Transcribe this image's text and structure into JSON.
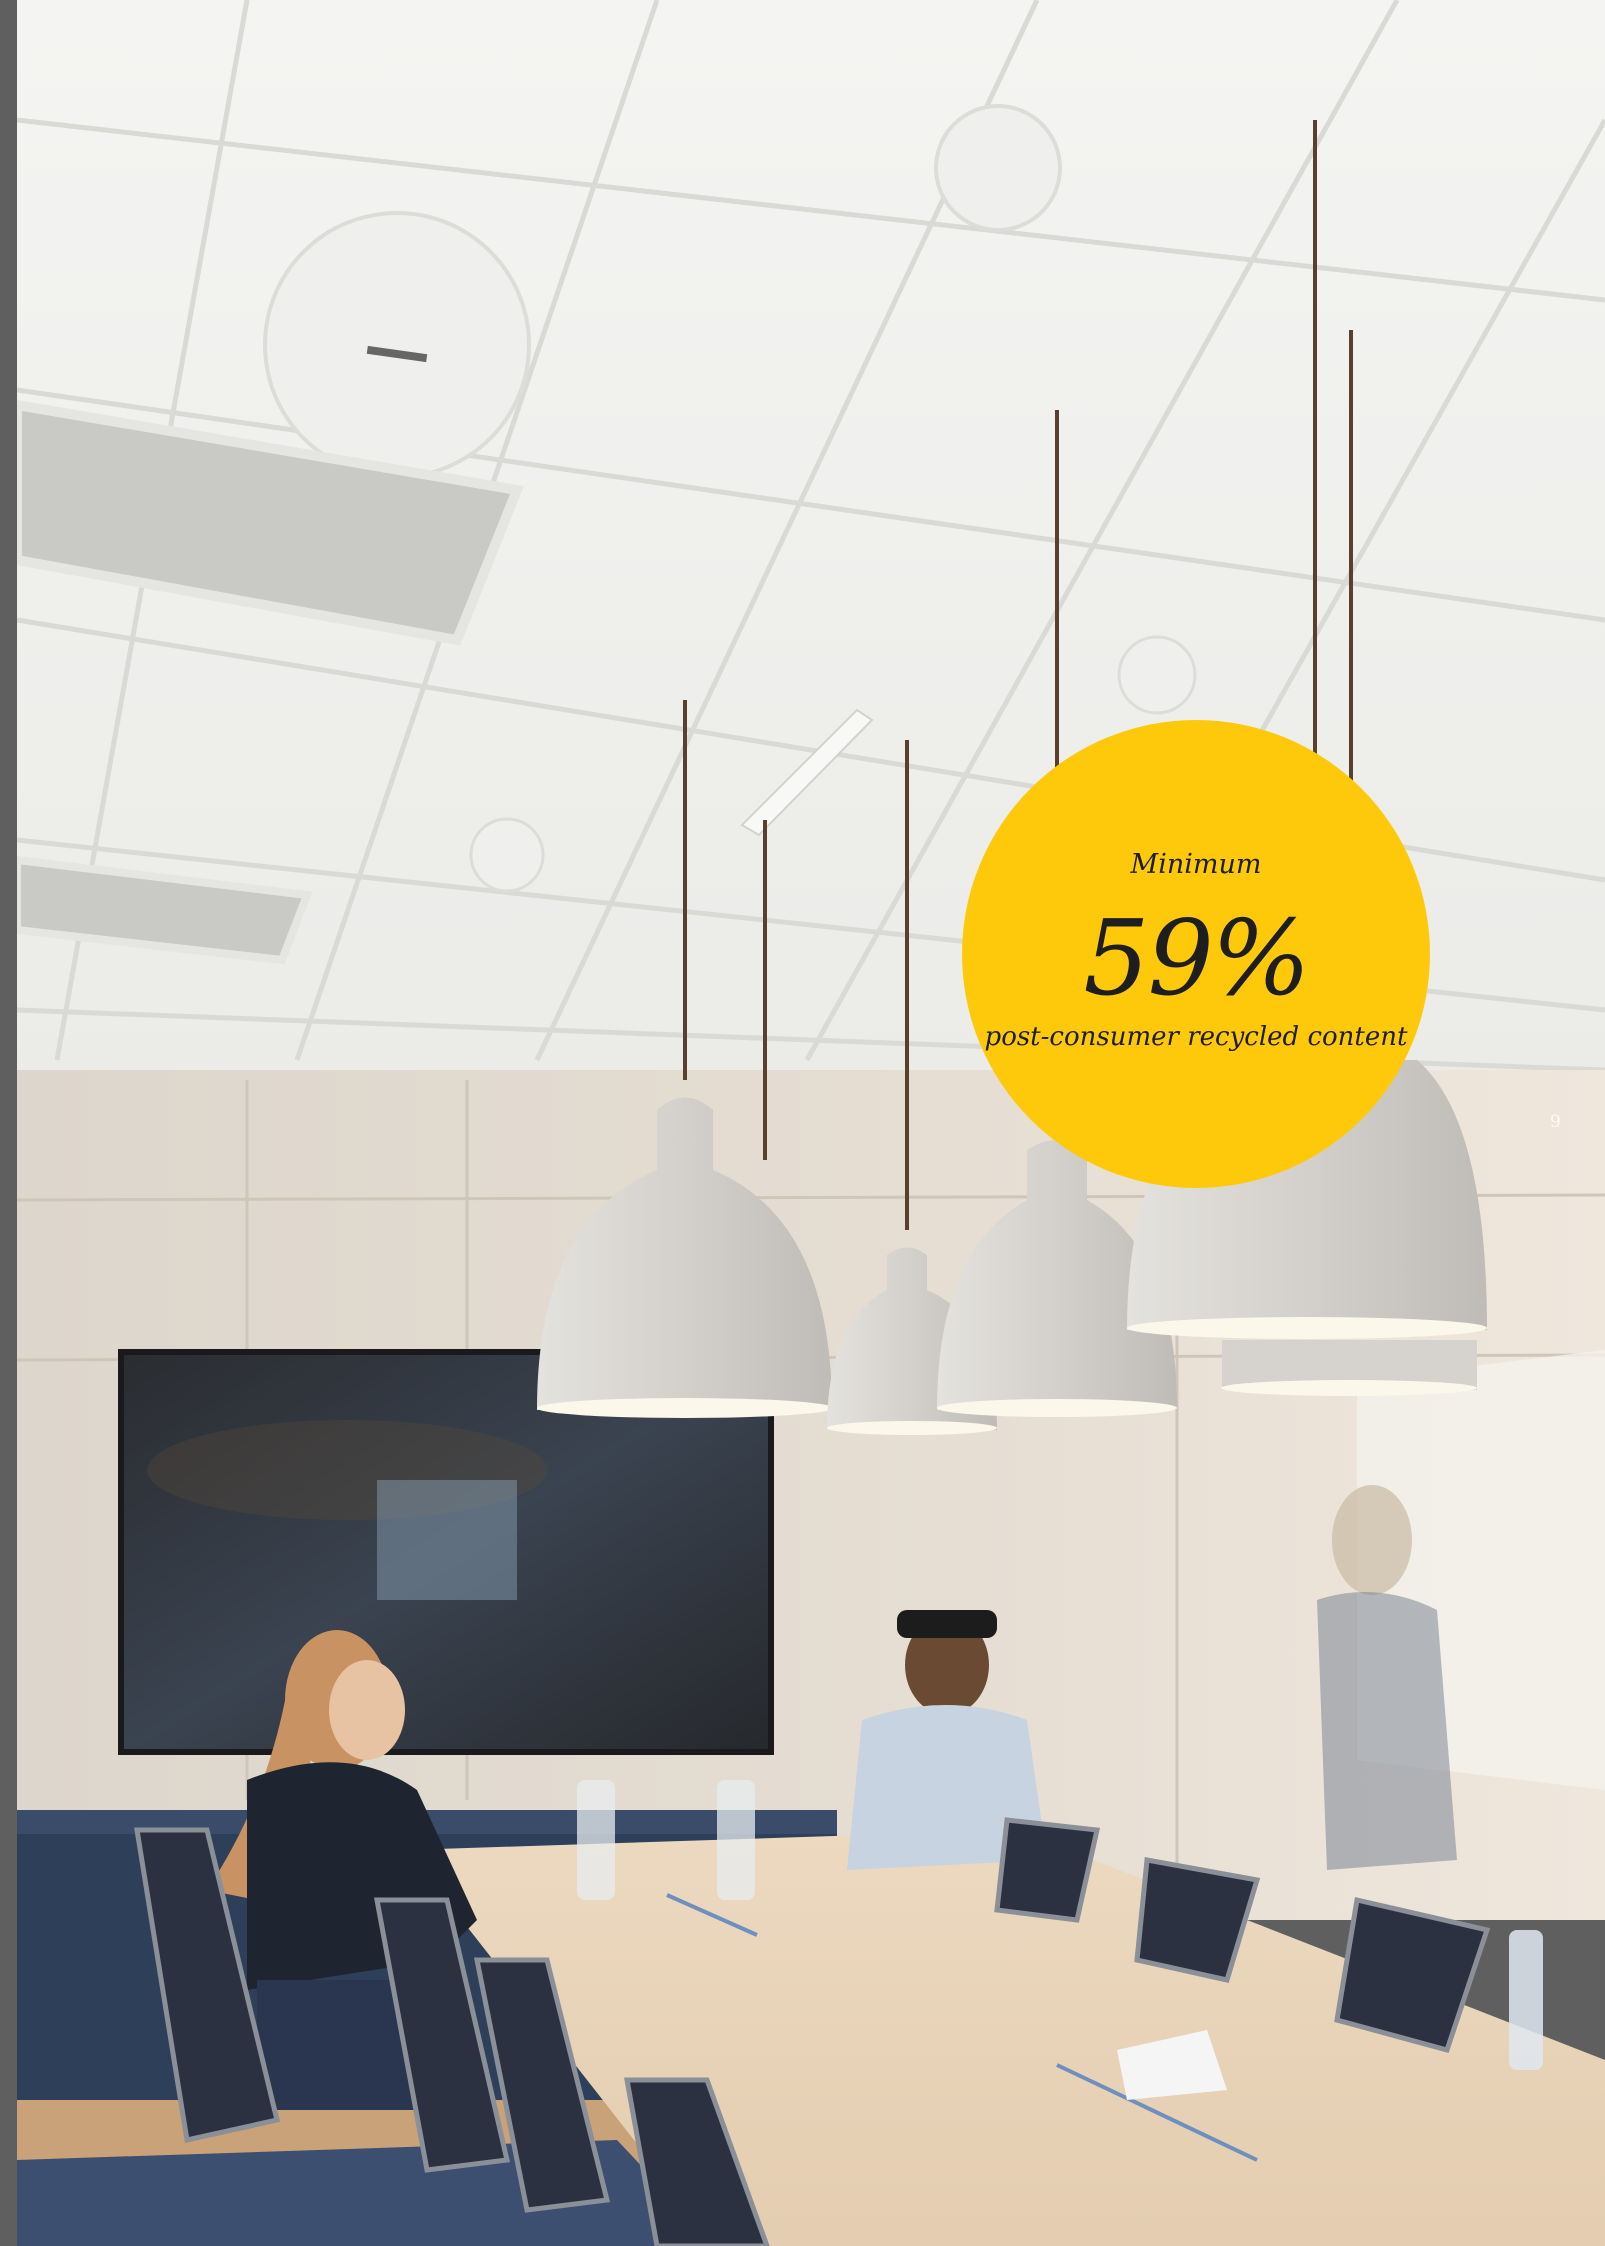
{
  "badge": {
    "label": "Minimum",
    "value": "59%",
    "caption": "post-consumer recycled content",
    "color": "#ffc90b"
  },
  "page_number": "9",
  "photo": {
    "icon": "meeting-room-photo"
  }
}
